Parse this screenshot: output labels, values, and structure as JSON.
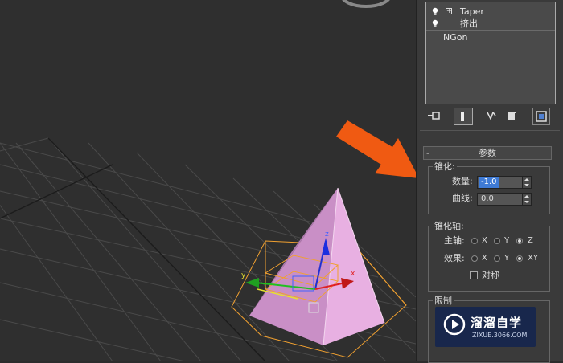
{
  "modifier_stack": {
    "items": [
      {
        "label": "Taper",
        "has_expand": true
      },
      {
        "label": "挤出",
        "has_expand": false
      },
      {
        "label": "NGon",
        "has_expand": false
      }
    ]
  },
  "stack_toolbar": {
    "icons": [
      "pin-stack-icon",
      "show-end-result-icon",
      "make-unique-icon",
      "remove-modifier-icon",
      "configure-modifier-sets-icon"
    ]
  },
  "params": {
    "header": "参数",
    "collapse": "-",
    "taper_group": "锥化:",
    "amount_label": "数量:",
    "amount_value": "-1.0",
    "curve_label": "曲线:",
    "curve_value": "0.0",
    "axis_group": "锥化轴:",
    "primary_label": "主轴:",
    "primary_options": [
      "X",
      "Y",
      "Z"
    ],
    "primary_selected": "Z",
    "effect_label": "效果:",
    "effect_options": [
      "X",
      "Y",
      "XY"
    ],
    "effect_selected": "XY",
    "symmetry_label": "对称",
    "symmetry_checked": false,
    "limit_group": "限制"
  },
  "gizmo_axes": {
    "x": "x",
    "y": "y",
    "z": "z"
  },
  "watermark": {
    "title": "溜溜自学",
    "url": "ZIXUE.3066.COM"
  },
  "colors": {
    "viewport_bg": "#2f2f2f",
    "grid": "#4a4a4a",
    "pyramid_face": "#e2a6dc",
    "selection_box": "#f0a030",
    "annotation_arrow": "#f05a12",
    "highlight": "#3f7bd6"
  }
}
